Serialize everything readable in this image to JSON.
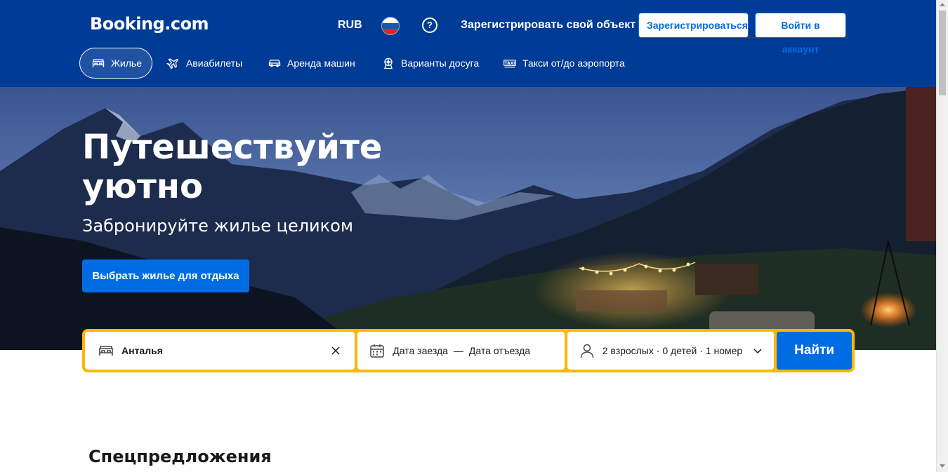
{
  "header": {
    "logo": "Booking.com",
    "currency": "RUB",
    "flag": "russia-flag",
    "help_glyph": "?",
    "list_property": "Зарегистрировать свой объект",
    "register_label": "Зарегистрироваться",
    "login_label": "Войти в аккаунт",
    "colors": {
      "background": "#003b95",
      "accent": "#006ce4"
    }
  },
  "nav": {
    "items": [
      {
        "label": "Жилье",
        "icon": "bed-icon",
        "active": true
      },
      {
        "label": "Авиабилеты",
        "icon": "plane-icon",
        "active": false
      },
      {
        "label": "Аренда машин",
        "icon": "car-icon",
        "active": false
      },
      {
        "label": "Варианты досуга",
        "icon": "attractions-icon",
        "active": false
      },
      {
        "label": "Такси от/до аэропорта",
        "icon": "taxi-icon",
        "active": false
      }
    ]
  },
  "hero": {
    "title": "Путешествуйте уютно",
    "subtitle": "Забронируйте жилье целиком",
    "cta_label": "Выбрать жилье для отдыха"
  },
  "search": {
    "destination_value": "Анталья",
    "checkin_label": "Дата заезда",
    "date_separator": "—",
    "checkout_label": "Дата отъезда",
    "guests_value": "2 взрослых · 0 детей · 1 номер",
    "submit_label": "Найти",
    "colors": {
      "border": "#ffb700",
      "button": "#006ce4"
    }
  },
  "main": {
    "section_title": "Спецпредложения"
  }
}
